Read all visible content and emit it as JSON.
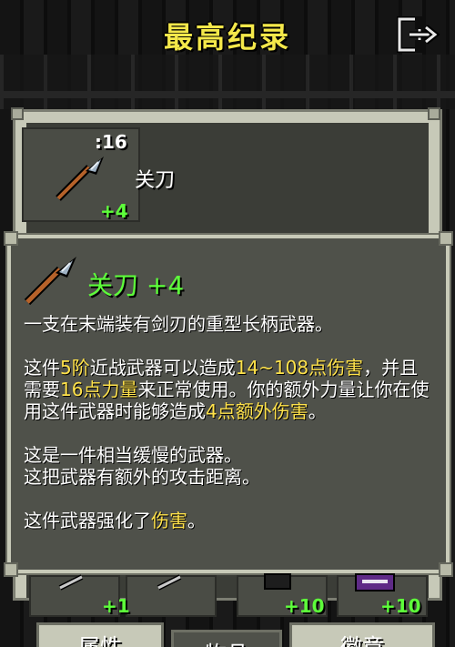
{
  "header": {
    "title": "最高纪录",
    "exit_icon": "exit-door-icon"
  },
  "record_entry": {
    "count": ":16",
    "name": "关刀",
    "level": "+4",
    "weapon_icon": "glaive-icon"
  },
  "tooltip": {
    "title": "关刀 +4",
    "weapon_icon": "glaive-icon",
    "desc": "一支在末端装有剑刃的重型长柄武器。",
    "stats": [
      {
        "text": "这件",
        "hl": false
      },
      {
        "text": "5阶",
        "hl": true
      },
      {
        "text": "近战武器可以造成",
        "hl": false
      },
      {
        "text": "14~108点伤害",
        "hl": true
      },
      {
        "text": "，并且需要",
        "hl": false
      },
      {
        "text": "16点力量",
        "hl": true
      },
      {
        "text": "来正常使用。你的额外力量让你在使用这件武器时能够造成",
        "hl": false
      },
      {
        "text": "4点额外伤害",
        "hl": true
      },
      {
        "text": "。",
        "hl": false
      }
    ],
    "speed_line1": "这是一件相当缓慢的武器。",
    "speed_line2": "这把武器有额外的攻击距离。",
    "upgrade": [
      {
        "text": "这件武器强化了",
        "hl": false
      },
      {
        "text": "伤害",
        "hl": true
      },
      {
        "text": "。",
        "hl": false
      }
    ]
  },
  "inventory": {
    "slots": [
      {
        "level": "+1",
        "icon": "dart-icon"
      },
      {
        "level": "",
        "icon": "dart-icon"
      },
      {
        "level": "+10",
        "icon": "armor-icon"
      },
      {
        "level": "+10",
        "icon": "spellbook-icon"
      }
    ]
  },
  "tabs": [
    {
      "label": "属性"
    },
    {
      "label": "物品"
    },
    {
      "label": "徽章"
    }
  ],
  "colors": {
    "title_yellow": "#f4e84a",
    "level_green": "#5dff3a",
    "highlight_yellow": "#ffe24a",
    "panel_light": "#c7c9b8",
    "panel_dark": "#4f514a"
  }
}
